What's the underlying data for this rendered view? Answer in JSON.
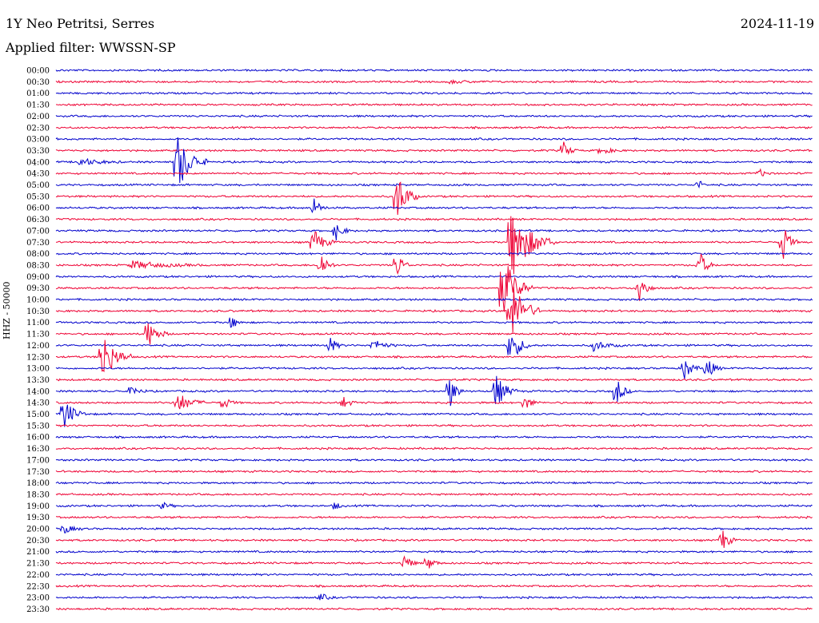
{
  "header": {
    "station": "1Y Neo Petritsi, Serres",
    "date": "2024-11-19",
    "filter": "Applied filter: WWSSN-SP",
    "channel_label": "HHZ - 50000"
  },
  "chart_data": {
    "type": "line",
    "title": "1Y Neo Petritsi, Serres",
    "subtitle": "Applied filter: WWSSN-SP",
    "ylabel": "HHZ - 50000",
    "trace_colors": [
      "#0000cc",
      "#ee0033"
    ],
    "time_labels": [
      "00:00",
      "00:30",
      "01:00",
      "01:30",
      "02:00",
      "02:30",
      "03:00",
      "03:30",
      "04:00",
      "04:30",
      "05:00",
      "05:30",
      "06:00",
      "06:30",
      "07:00",
      "07:30",
      "08:00",
      "08:30",
      "09:00",
      "09:30",
      "10:00",
      "10:30",
      "11:00",
      "11:30",
      "12:00",
      "12:30",
      "13:00",
      "13:30",
      "14:00",
      "14:30",
      "15:00",
      "15:30",
      "16:00",
      "16:30",
      "17:00",
      "17:30",
      "18:00",
      "18:30",
      "19:00",
      "19:30",
      "20:00",
      "20:30",
      "21:00",
      "21:30",
      "22:00",
      "22:30",
      "23:00",
      "23:30"
    ],
    "events": [
      {
        "row": 1,
        "x": 0.52,
        "amp": 2,
        "dur": 0.05
      },
      {
        "row": 7,
        "x": 0.67,
        "amp": 12,
        "dur": 0.02
      },
      {
        "row": 7,
        "x": 0.72,
        "amp": 5,
        "dur": 0.03
      },
      {
        "row": 8,
        "x": 0.03,
        "amp": 5,
        "dur": 0.06
      },
      {
        "row": 8,
        "x": 0.16,
        "amp": 40,
        "dur": 0.04
      },
      {
        "row": 9,
        "x": 0.93,
        "amp": 5,
        "dur": 0.02
      },
      {
        "row": 10,
        "x": 0.85,
        "amp": 7,
        "dur": 0.01
      },
      {
        "row": 11,
        "x": 0.45,
        "amp": 35,
        "dur": 0.03
      },
      {
        "row": 12,
        "x": 0.34,
        "amp": 14,
        "dur": 0.02
      },
      {
        "row": 14,
        "x": 0.37,
        "amp": 12,
        "dur": 0.02
      },
      {
        "row": 15,
        "x": 0.34,
        "amp": 18,
        "dur": 0.03
      },
      {
        "row": 15,
        "x": 0.6,
        "amp": 50,
        "dur": 0.06
      },
      {
        "row": 15,
        "x": 0.96,
        "amp": 28,
        "dur": 0.02
      },
      {
        "row": 17,
        "x": 0.35,
        "amp": 18,
        "dur": 0.02
      },
      {
        "row": 17,
        "x": 0.45,
        "amp": 18,
        "dur": 0.02
      },
      {
        "row": 17,
        "x": 0.85,
        "amp": 20,
        "dur": 0.02
      },
      {
        "row": 17,
        "x": 0.1,
        "amp": 5,
        "dur": 0.1
      },
      {
        "row": 19,
        "x": 0.77,
        "amp": 25,
        "dur": 0.02
      },
      {
        "row": 19,
        "x": 0.59,
        "amp": 45,
        "dur": 0.04
      },
      {
        "row": 21,
        "x": 0.6,
        "amp": 45,
        "dur": 0.04
      },
      {
        "row": 22,
        "x": 0.23,
        "amp": 10,
        "dur": 0.02
      },
      {
        "row": 23,
        "x": 0.12,
        "amp": 20,
        "dur": 0.03
      },
      {
        "row": 24,
        "x": 0.36,
        "amp": 14,
        "dur": 0.02
      },
      {
        "row": 24,
        "x": 0.42,
        "amp": 8,
        "dur": 0.03
      },
      {
        "row": 24,
        "x": 0.6,
        "amp": 25,
        "dur": 0.03
      },
      {
        "row": 24,
        "x": 0.71,
        "amp": 7,
        "dur": 0.04
      },
      {
        "row": 25,
        "x": 0.06,
        "amp": 35,
        "dur": 0.04
      },
      {
        "row": 26,
        "x": 0.83,
        "amp": 18,
        "dur": 0.02
      },
      {
        "row": 26,
        "x": 0.86,
        "amp": 16,
        "dur": 0.02
      },
      {
        "row": 28,
        "x": 0.1,
        "amp": 8,
        "dur": 0.02
      },
      {
        "row": 28,
        "x": 0.52,
        "amp": 22,
        "dur": 0.02
      },
      {
        "row": 28,
        "x": 0.58,
        "amp": 25,
        "dur": 0.03
      },
      {
        "row": 28,
        "x": 0.74,
        "amp": 20,
        "dur": 0.02
      },
      {
        "row": 29,
        "x": 0.16,
        "amp": 14,
        "dur": 0.04
      },
      {
        "row": 29,
        "x": 0.22,
        "amp": 10,
        "dur": 0.02
      },
      {
        "row": 29,
        "x": 0.38,
        "amp": 8,
        "dur": 0.02
      },
      {
        "row": 29,
        "x": 0.62,
        "amp": 10,
        "dur": 0.02
      },
      {
        "row": 30,
        "x": 0.01,
        "amp": 22,
        "dur": 0.03
      },
      {
        "row": 38,
        "x": 0.14,
        "amp": 5,
        "dur": 0.02
      },
      {
        "row": 38,
        "x": 0.37,
        "amp": 7,
        "dur": 0.01
      },
      {
        "row": 40,
        "x": 0.01,
        "amp": 6,
        "dur": 0.03
      },
      {
        "row": 41,
        "x": 0.88,
        "amp": 16,
        "dur": 0.02
      },
      {
        "row": 43,
        "x": 0.46,
        "amp": 12,
        "dur": 0.02
      },
      {
        "row": 43,
        "x": 0.49,
        "amp": 10,
        "dur": 0.02
      },
      {
        "row": 46,
        "x": 0.35,
        "amp": 5,
        "dur": 0.02
      }
    ]
  }
}
